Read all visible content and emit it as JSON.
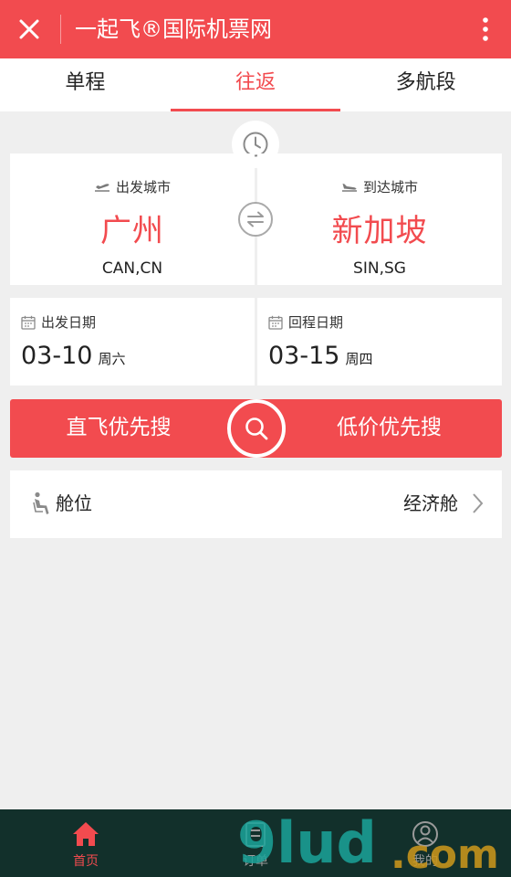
{
  "header": {
    "title": "一起飞®国际机票网",
    "close_icon": "close-icon",
    "more_icon": "more-vertical-icon"
  },
  "tabs": [
    {
      "label": "单程",
      "active": false
    },
    {
      "label": "往返",
      "active": true
    },
    {
      "label": "多航段",
      "active": false
    }
  ],
  "departure": {
    "label": "出发城市",
    "city": "广州",
    "code": "CAN,CN"
  },
  "arrival": {
    "label": "到达城市",
    "city": "新加坡",
    "code": "SIN,SG"
  },
  "depart_date": {
    "label": "出发日期",
    "date": "03-10",
    "weekday": "周六"
  },
  "return_date": {
    "label": "回程日期",
    "date": "03-15",
    "weekday": "周四"
  },
  "search": {
    "direct_label": "直飞优先搜",
    "cheap_label": "低价优先搜"
  },
  "cabin": {
    "label": "舱位",
    "value": "经济舱"
  },
  "bottom_nav": [
    {
      "label": "首页",
      "active": true
    },
    {
      "label": "订单",
      "active": false
    },
    {
      "label": "我的",
      "active": false
    }
  ],
  "watermark": {
    "text": "9lud.com"
  },
  "colors": {
    "accent": "#f24b4f",
    "background": "#efefef",
    "bottom_bar": "#12302b"
  }
}
